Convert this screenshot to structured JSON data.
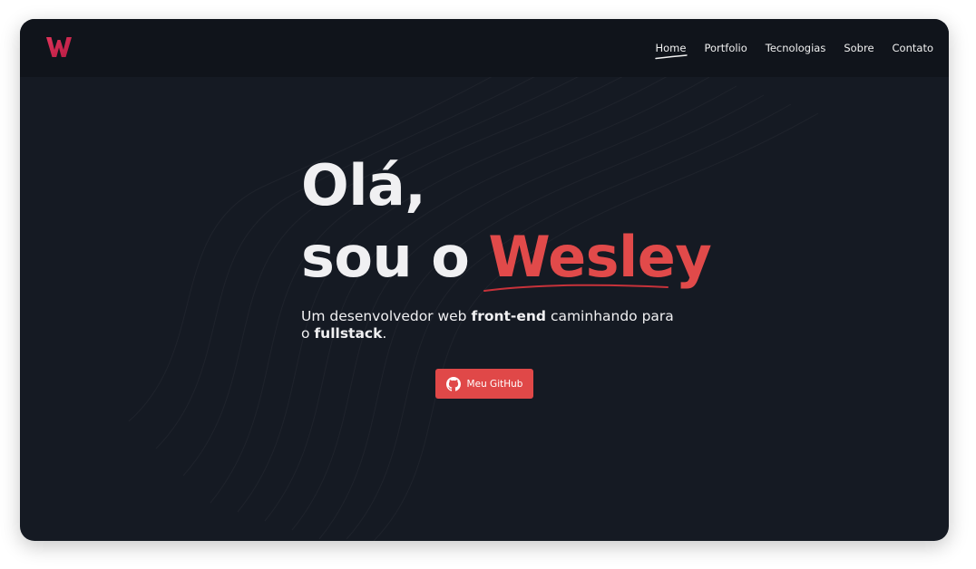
{
  "header": {
    "logo": "W",
    "nav": [
      {
        "label": "Home",
        "active": true
      },
      {
        "label": "Portfolio"
      },
      {
        "label": "Tecnologias"
      },
      {
        "label": "Sobre"
      },
      {
        "label": "Contato"
      }
    ]
  },
  "hero": {
    "line1": "Olá,",
    "line2_prefix": "sou o ",
    "name": "Wesley",
    "subtitle": {
      "part1": "Um desenvolvedor web ",
      "bold1": "front-end",
      "part2": " caminhando para o ",
      "bold2": "fullstack",
      "part3": "."
    },
    "button": {
      "label": "Meu GitHub",
      "icon": "github-icon"
    }
  },
  "colors": {
    "background": "#151a23",
    "topbar": "#10141b",
    "accent": "#e14a4a",
    "text": "#f0f0f2"
  }
}
